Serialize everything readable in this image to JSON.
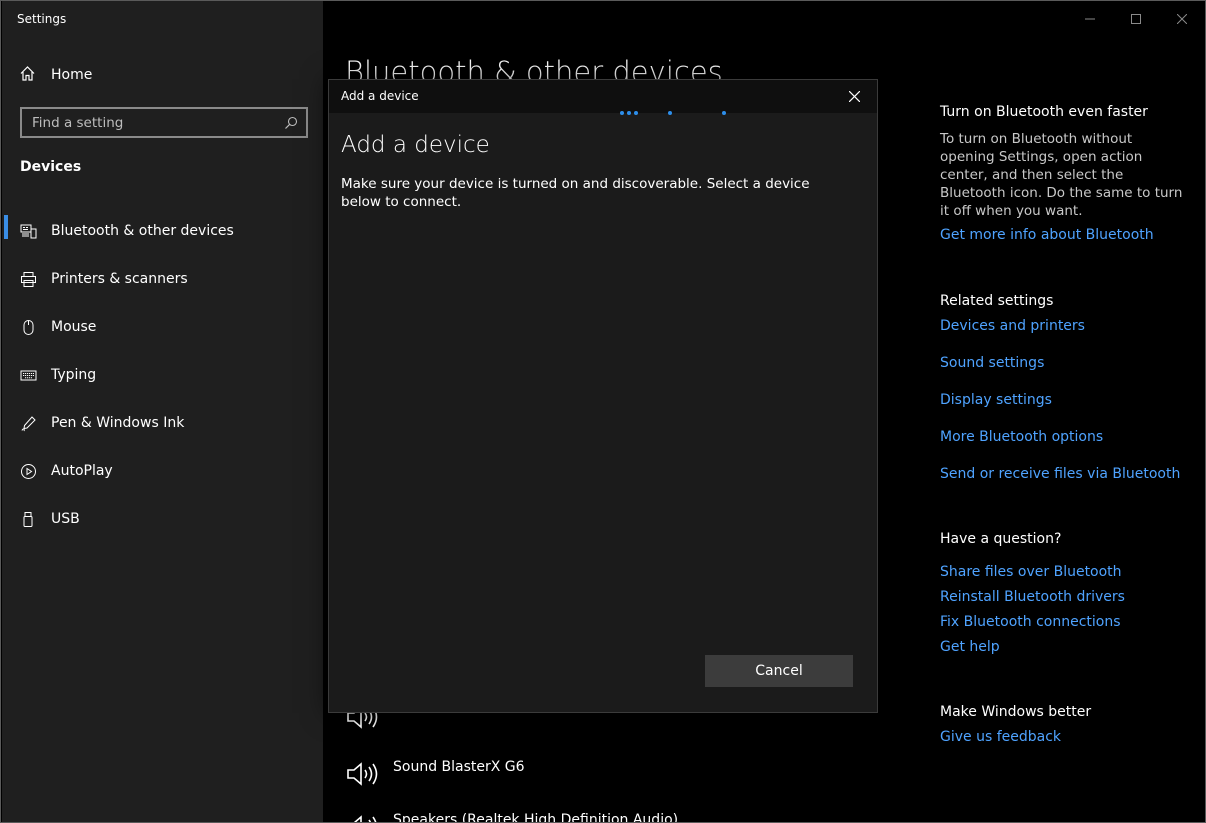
{
  "window": {
    "title": "Settings"
  },
  "sidebar": {
    "home_label": "Home",
    "search_placeholder": "Find a setting",
    "section_title": "Devices",
    "items": [
      {
        "label": "Bluetooth & other devices",
        "icon": "bluetooth-devices-icon",
        "active": true
      },
      {
        "label": "Printers & scanners",
        "icon": "printer-icon"
      },
      {
        "label": "Mouse",
        "icon": "mouse-icon"
      },
      {
        "label": "Typing",
        "icon": "keyboard-icon"
      },
      {
        "label": "Pen & Windows Ink",
        "icon": "pen-icon"
      },
      {
        "label": "AutoPlay",
        "icon": "autoplay-icon"
      },
      {
        "label": "USB",
        "icon": "usb-icon"
      }
    ]
  },
  "main": {
    "page_title": "Bluetooth & other devices",
    "devices": [
      {
        "label": "Sound BlasterX G6",
        "icon": "speaker-icon"
      },
      {
        "label": "Speakers (Realtek High Definition Audio)",
        "icon": "speaker-icon"
      }
    ]
  },
  "dialog": {
    "title": "Add a device",
    "heading": "Add a device",
    "description": "Make sure your device is turned on and discoverable. Select a device below to connect.",
    "cancel_label": "Cancel",
    "accent": "#2d8eea"
  },
  "right_panel": {
    "bt_heading": "Turn on Bluetooth even faster",
    "bt_text": "To turn on Bluetooth without opening Settings, open action center, and then select the Bluetooth icon. Do the same to turn it off when you want.",
    "bt_link": "Get more info about Bluetooth",
    "related_heading": "Related settings",
    "related_links": [
      "Devices and printers",
      "Sound settings",
      "Display settings",
      "More Bluetooth options",
      "Send or receive files via Bluetooth"
    ],
    "question_heading": "Have a question?",
    "question_links": [
      "Share files over Bluetooth",
      "Reinstall Bluetooth drivers",
      "Fix Bluetooth connections",
      "Get help"
    ],
    "better_heading": "Make Windows better",
    "feedback_link": "Give us feedback",
    "link_color": "#4fa3ff"
  }
}
